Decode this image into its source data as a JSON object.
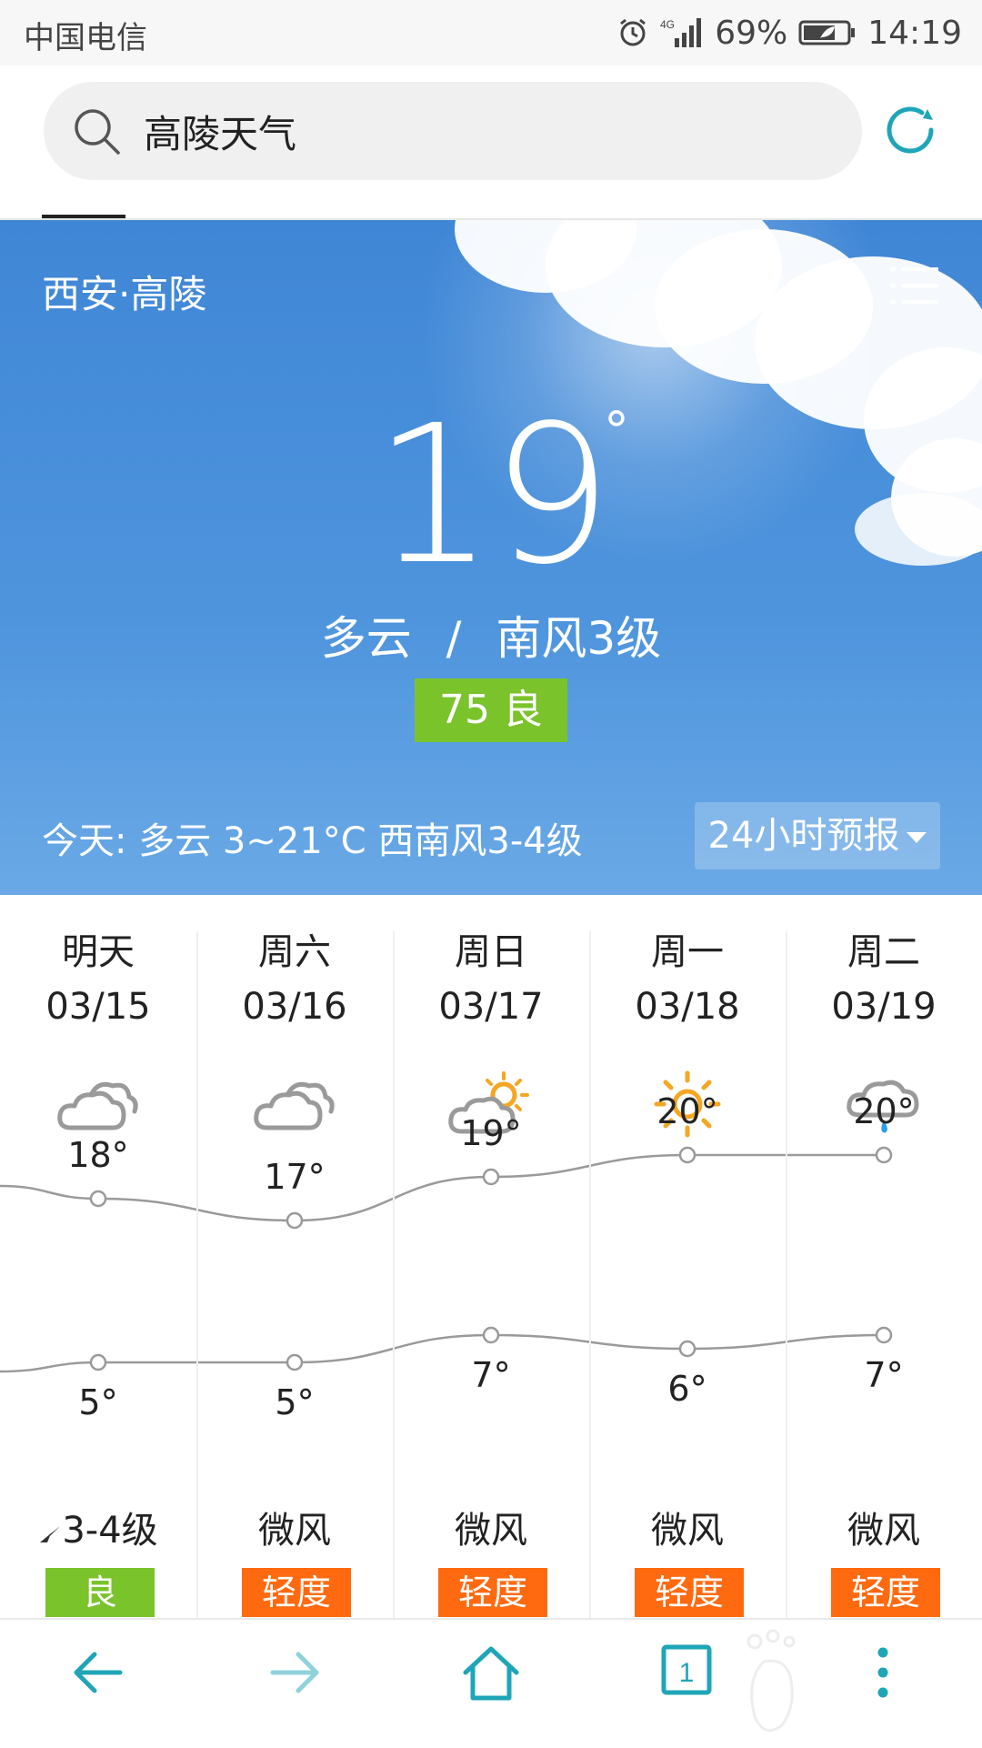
{
  "status_bar": {
    "carrier": "中国电信",
    "network": "4G",
    "battery": "69%",
    "time": "14:19"
  },
  "search": {
    "query": "高陵天气"
  },
  "weather": {
    "location": "西安·高陵",
    "temperature": "19",
    "unit": "°",
    "condition": "多云",
    "separator": "/",
    "wind": "南风3级",
    "aqi": "75 良",
    "today_summary": "今天:  多云   3~21°C   西南风3-4级",
    "forecast_24h_label": "24小时预报"
  },
  "forecast": {
    "days": [
      {
        "day": "明天",
        "date": "03/15",
        "icon": "cloudy-icon",
        "high": 18,
        "high_label": "18°",
        "low": 5,
        "low_label": "5°",
        "wind": "3-4级",
        "wind_arrow": true,
        "aqi": "良",
        "aqi_color": "#7ac32b"
      },
      {
        "day": "周六",
        "date": "03/16",
        "icon": "cloudy-icon",
        "high": 17,
        "high_label": "17°",
        "low": 5,
        "low_label": "5°",
        "wind": "微风",
        "wind_arrow": false,
        "aqi": "轻度",
        "aqi_color": "#ff6a10"
      },
      {
        "day": "周日",
        "date": "03/17",
        "icon": "partly-cloudy-icon",
        "high": 19,
        "high_label": "19°",
        "low": 7,
        "low_label": "7°",
        "wind": "微风",
        "wind_arrow": false,
        "aqi": "轻度",
        "aqi_color": "#ff6a10"
      },
      {
        "day": "周一",
        "date": "03/18",
        "icon": "sunny-icon",
        "high": 20,
        "high_label": "20°",
        "low": 6,
        "low_label": "6°",
        "wind": "微风",
        "wind_arrow": false,
        "aqi": "轻度",
        "aqi_color": "#ff6a10"
      },
      {
        "day": "周二",
        "date": "03/19",
        "icon": "light-rain-icon",
        "high": 20,
        "high_label": "20°",
        "low": 7,
        "low_label": "7°",
        "wind": "微风",
        "wind_arrow": false,
        "aqi": "轻度",
        "aqi_color": "#ff6a10"
      }
    ]
  },
  "nav": {
    "tab_count": "1"
  },
  "colors": {
    "accent": "#1fa5b8",
    "hero_blue": "#4a90dc",
    "aqi_good": "#7ac32b",
    "aqi_light": "#ff6a10"
  }
}
